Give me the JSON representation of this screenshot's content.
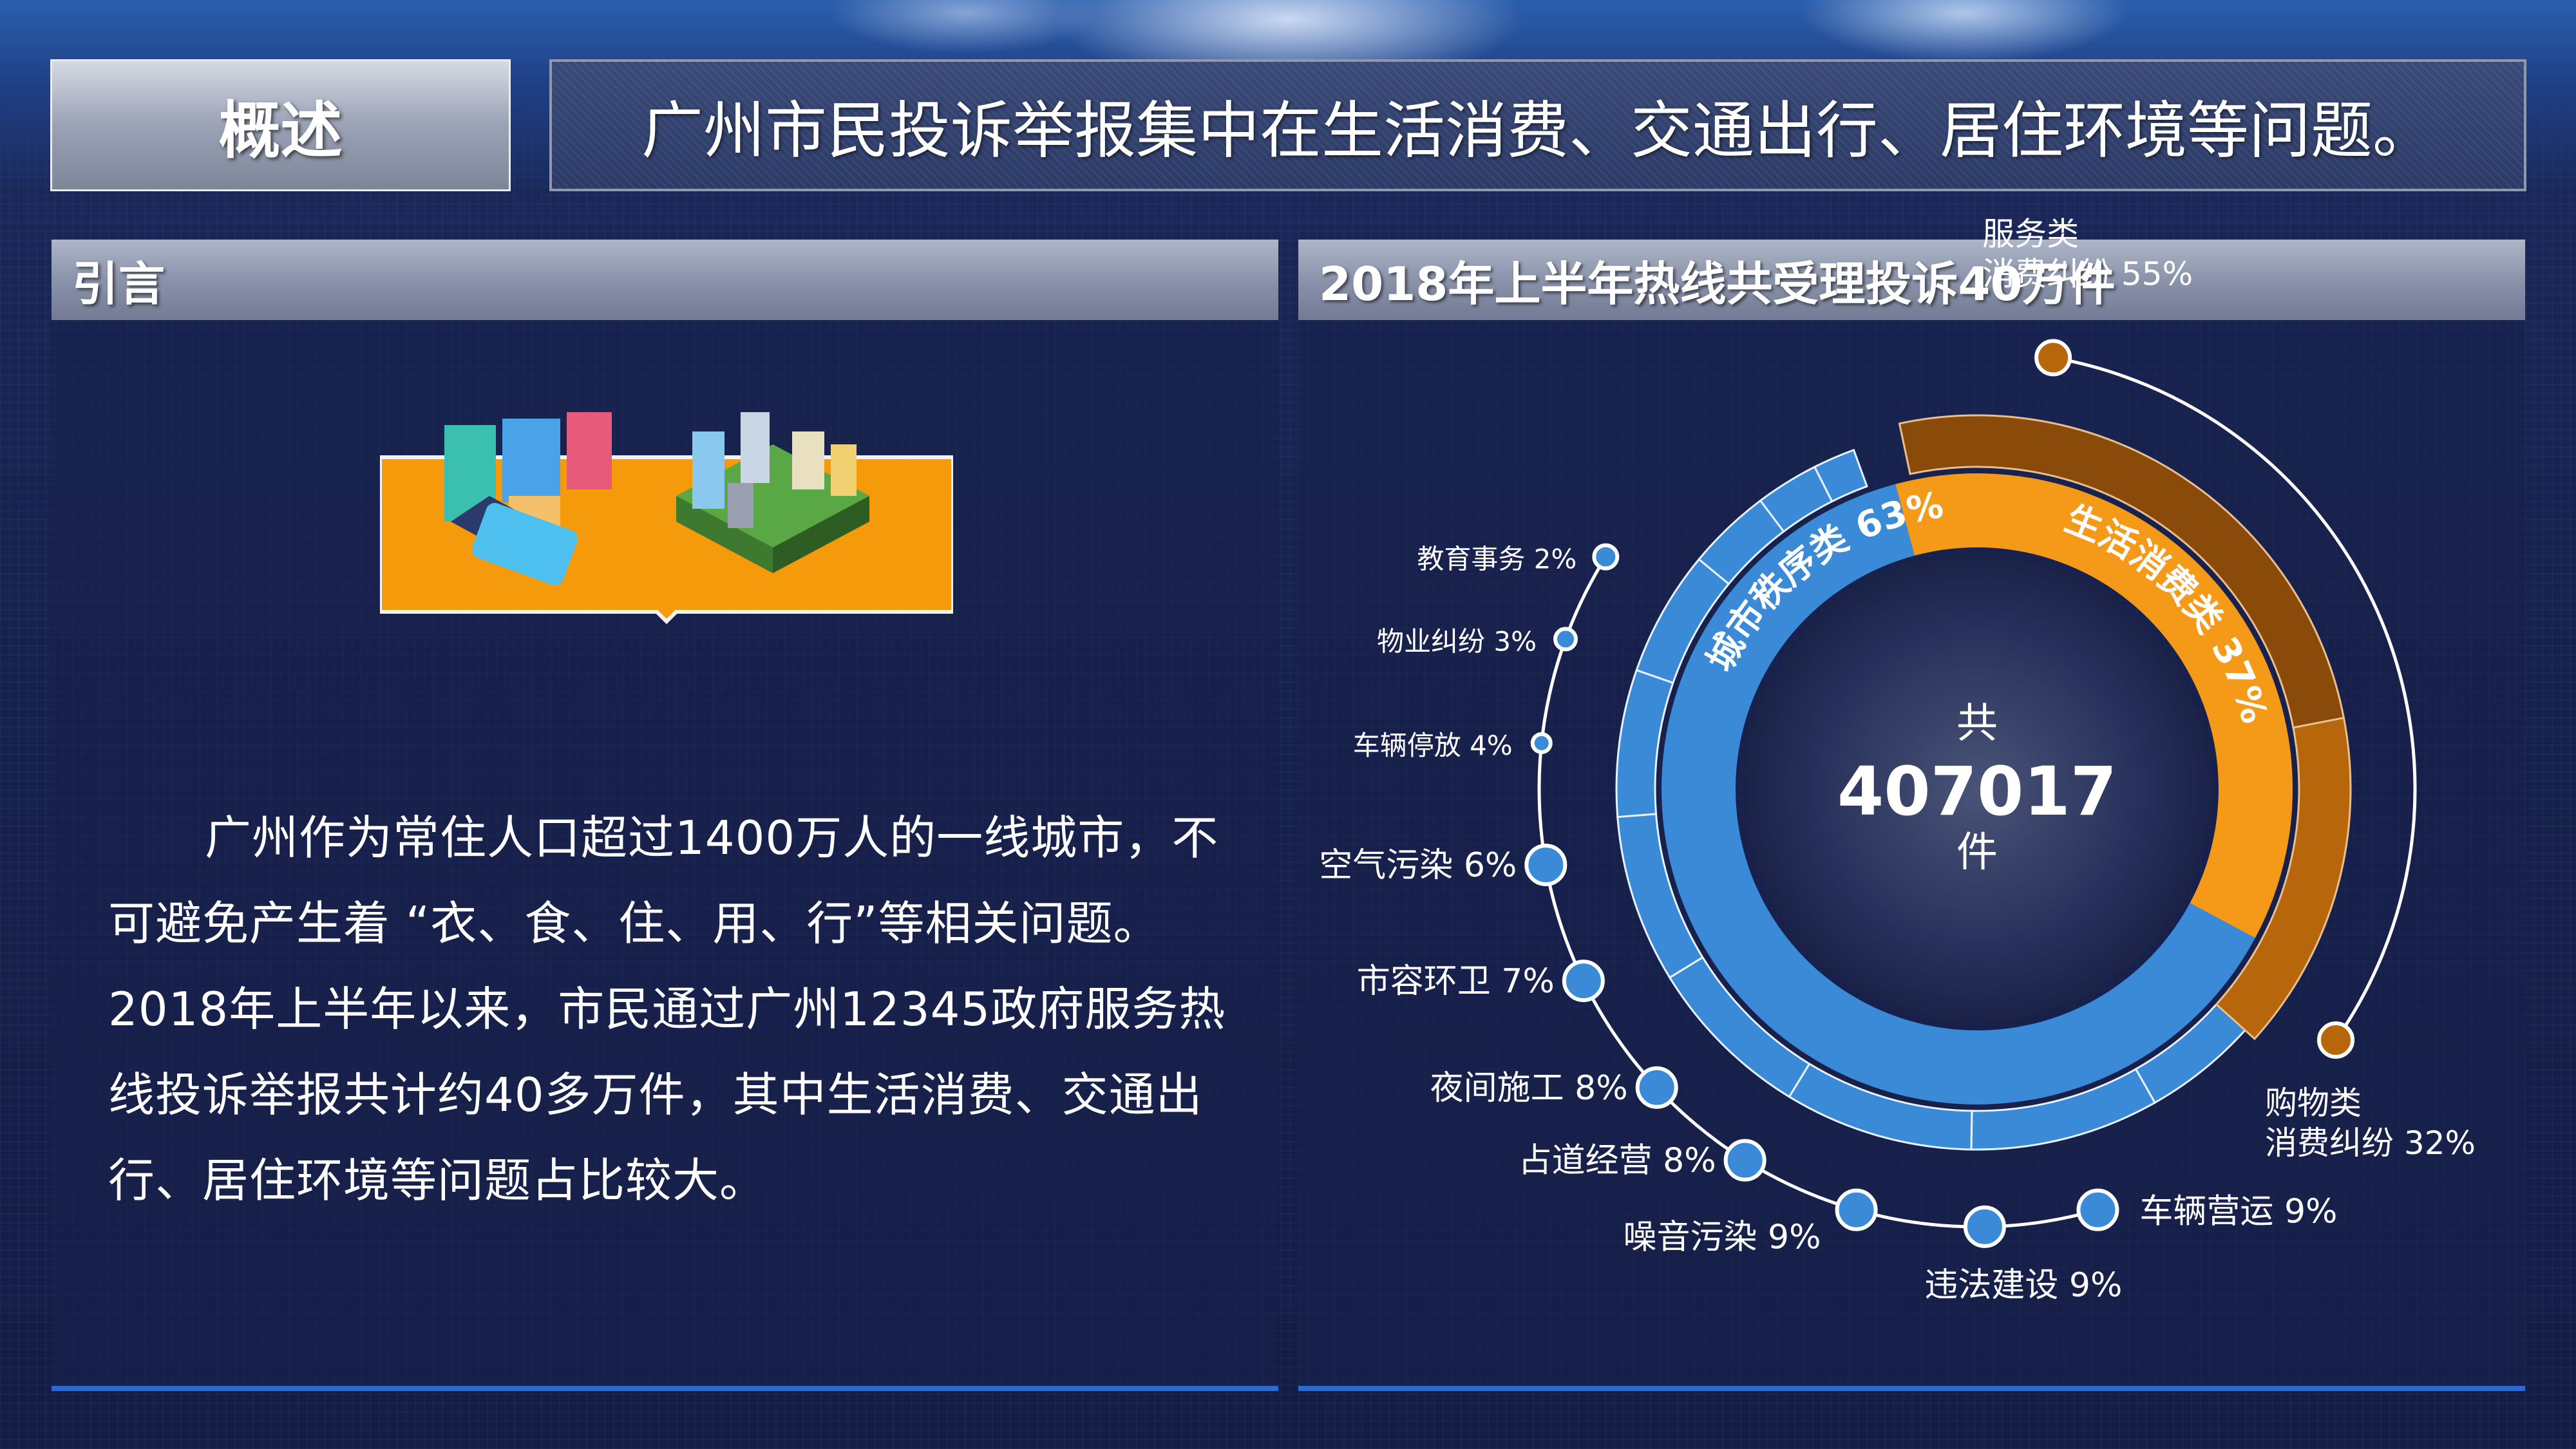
{
  "header": {
    "title": "概述",
    "headline": "广州市民投诉举报集中在生活消费、交通出行、居住环境等问题。"
  },
  "left_panel": {
    "heading": "引言",
    "intro_text": "广州作为常住人口超过1400万人的一线城市，不可避免产生着 “衣、食、住、用、行”等相关问题。2018年上半年以来，市民通过广州12345政府服务热线投诉举报共计约40多万件，其中生活消费、交通出行、居住环境等问题占比较大。"
  },
  "right_panel": {
    "heading": "2018年上半年热线共受理投诉40万件"
  },
  "colors": {
    "blue": "#3a8ad8",
    "orange": "#f59a18",
    "brown": "#8a4a0a",
    "accent_line": "#2a6ad6"
  },
  "chart_data": {
    "type": "pie",
    "center": {
      "prefix": "共",
      "total": "407017",
      "suffix": "件"
    },
    "inner_ring": [
      {
        "name": "城市秩序类",
        "percent": 63,
        "label": "城市秩序类 63%",
        "color": "#3a8ad8"
      },
      {
        "name": "生活消费类",
        "percent": 37,
        "label": "生活消费类 37%",
        "color": "#f59a18"
      }
    ],
    "consumption_breakdown": [
      {
        "name": "服务类消费纠纷",
        "line1": "服务类",
        "line2": "消费纠纷 55%",
        "percent": 55
      },
      {
        "name": "购物类消费纠纷",
        "line1": "购物类",
        "line2": "消费纠纷 32%",
        "percent": 32
      }
    ],
    "order_breakdown": [
      {
        "name": "车辆营运",
        "label": "车辆营运 9%",
        "percent": 9
      },
      {
        "name": "违法建设",
        "label": "违法建设 9%",
        "percent": 9
      },
      {
        "name": "噪音污染",
        "label": "噪音污染 9%",
        "percent": 9
      },
      {
        "name": "占道经营",
        "label": "占道经营 8%",
        "percent": 8
      },
      {
        "name": "夜间施工",
        "label": "夜间施工 8%",
        "percent": 8
      },
      {
        "name": "市容环卫",
        "label": "市容环卫 7%",
        "percent": 7
      },
      {
        "name": "空气污染",
        "label": "空气污染 6%",
        "percent": 6
      },
      {
        "name": "车辆停放",
        "label": "车辆停放 4%",
        "percent": 4
      },
      {
        "name": "物业纠纷",
        "label": "物业纠纷 3%",
        "percent": 3
      },
      {
        "name": "教育事务",
        "label": "教育事务 2%",
        "percent": 2
      }
    ]
  }
}
